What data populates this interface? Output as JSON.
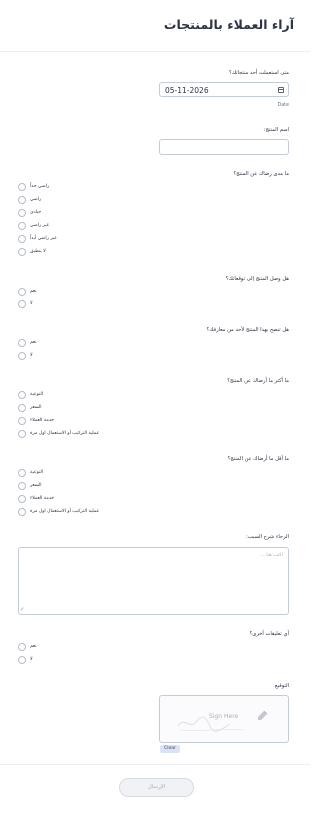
{
  "form": {
    "title": "آراء العملاء بالمنتجات"
  },
  "q_date": {
    "label": "متى استعملت أحد منتجاتك؟",
    "value": "05-11-2026",
    "sublabel": "Date"
  },
  "q_product": {
    "label": "اسم المنتج:",
    "value": ""
  },
  "q_satisfaction": {
    "label": "ما مدى رضاك عن المنتج؟",
    "options": [
      "راضي جداً",
      "راضي",
      "حيادي",
      "غير راضي",
      "غير راضي أبداً",
      "لا ينطبق"
    ]
  },
  "q_expectations": {
    "label": "هل وصل المنتج إلى توقعاتك؟",
    "options": [
      "نعم",
      "لا"
    ]
  },
  "q_recommend": {
    "label": "هل تنصح بهذا المنتج لأحد من معارفك؟",
    "options": [
      "نعم",
      "لا"
    ]
  },
  "q_most_liked": {
    "label": "ما أكثر ما أرضاك عن المنتج؟",
    "options": [
      "النوعية",
      "السعر",
      "خدمة العملاء",
      "عملية التركيب أو الاستعمال اول مرة"
    ]
  },
  "q_least_liked": {
    "label": "ما أقل ما أرضاك عن المنتج؟",
    "options": [
      "النوعية",
      "السعر",
      "خدمة العملاء",
      "عملية التركيب أو الاستعمال اول مرة"
    ]
  },
  "q_reason": {
    "label": "الرجاء شرح السبب:",
    "placeholder": "اكتب هنا ..."
  },
  "q_comments": {
    "label": "أي تعليقات أخرى؟",
    "options": [
      "نعم",
      "لا"
    ]
  },
  "q_signature": {
    "label": "التوقيع",
    "placeholder": "Sign Here",
    "clear_label": "Clear"
  },
  "submit_label": "الإرسال",
  "icons": {
    "date": "calendar-icon",
    "signature": "pen-icon"
  }
}
